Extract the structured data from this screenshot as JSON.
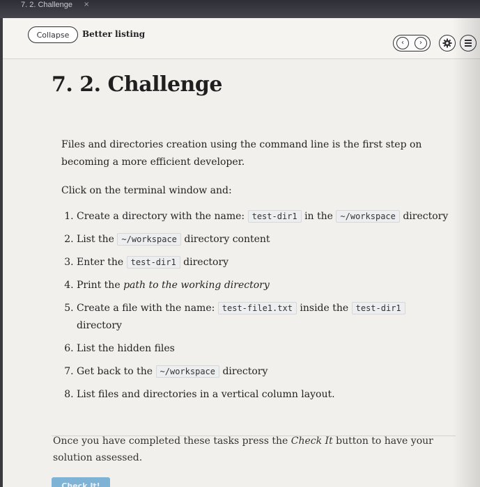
{
  "tab": {
    "title": "7. 2. Challenge",
    "close": "×"
  },
  "toolbar": {
    "collapse_label": "Collapse",
    "lesson_title": "Better listing",
    "prev_icon": "‹",
    "next_icon": "›"
  },
  "page_title": "7. 2. Challenge",
  "intro": "Files and directories creation using the command line is the first step on becoming a more efficient developer.",
  "instruction": "Click on the terminal window and:",
  "tasks": [
    {
      "pre": "Create a directory with the name: ",
      "code1": "test-dir1",
      "mid": " in the ",
      "code2": "~/workspace",
      "post": " directory"
    },
    {
      "pre": "List the ",
      "code1": "~/workspace",
      "post": " directory content"
    },
    {
      "pre": "Enter the ",
      "code1": "test-dir1",
      "post": " directory"
    },
    {
      "pre": "Print the ",
      "em": "path to the working directory"
    },
    {
      "pre": "Create a file with the name: ",
      "code1": "test-file1.txt",
      "mid": " inside the ",
      "code2": "test-dir1",
      "post": " directory"
    },
    {
      "pre": "List the hidden files"
    },
    {
      "pre": "Get back to the ",
      "code1": "~/workspace",
      "post": " directory"
    },
    {
      "pre": "List files and directories in a vertical column layout."
    }
  ],
  "footer": {
    "pre": "Once you have completed these tasks press the ",
    "em": "Check It",
    "post": " button to have your solution assessed."
  },
  "check_button": "Check It!"
}
